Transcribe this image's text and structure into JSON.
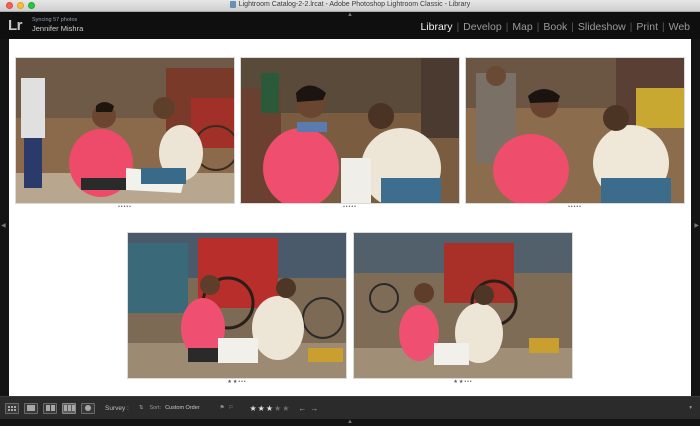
{
  "window": {
    "title": "Lightroom Catalog-2-2.lrcat - Adobe Photoshop Lightroom Classic - Library"
  },
  "identity": {
    "logo": "Lr",
    "sync_status": "Syncing 57 photos",
    "user_name": "Jennifer Mishra"
  },
  "modules": [
    "Library",
    "Develop",
    "Map",
    "Book",
    "Slideshow",
    "Print",
    "Web"
  ],
  "active_module": "Library",
  "survey": {
    "photos": [
      {
        "name": "photo-1",
        "stars": "•••••",
        "rating": 0
      },
      {
        "name": "photo-2",
        "stars": "•••••",
        "rating": 0
      },
      {
        "name": "photo-3",
        "stars": "•••••",
        "rating": 0
      },
      {
        "name": "photo-4",
        "stars": "★★•••",
        "rating": 2
      },
      {
        "name": "photo-5",
        "stars": "★★•••",
        "rating": 2
      }
    ]
  },
  "toolbar": {
    "view_label": "Survey :",
    "sort_label": "Sort:",
    "sort_value": "Custom Order",
    "rating_stars": "★★★",
    "rating_empty": "★★",
    "prev_icon": "←",
    "next_icon": "→"
  },
  "colors": {
    "accent_active": "#f2f2f2",
    "panel_bg": "#2b2b2b",
    "survey_bg": "#ffffff"
  }
}
